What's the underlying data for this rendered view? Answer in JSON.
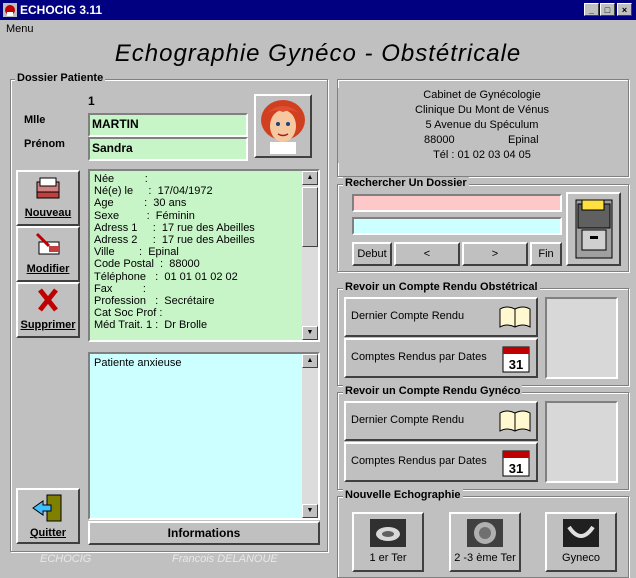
{
  "window": {
    "title": "ECHOCIG 3.11",
    "minimize": "_",
    "maximize": "□",
    "close": "×"
  },
  "menu": {
    "item": "Menu"
  },
  "banner": {
    "title": "Echographie Gynéco - Obstétricale"
  },
  "patient": {
    "group_label": "Dossier Patiente",
    "number": "1",
    "civility_label": "Mlle",
    "name": "MARTIN",
    "firstname_label": "Prénom",
    "firstname": "Sandra",
    "details": [
      "Née          :",
      "Né(e) le     :  17/04/1972",
      "Age          :  30 ans",
      "Sexe         :  Féminin",
      "Adress 1     :  17 rue des Abeilles",
      "Adress 2     :  17 rue des Abeilles",
      "Ville        :  Epinal",
      "Code Postal  :  88000",
      "Téléphone   :  01 01 01 02 02",
      "Fax          :",
      "Profession   :  Secrétaire",
      "Cat Soc Prof :",
      "Méd Trait. 1 :  Dr Brolle"
    ],
    "notes": "Patiente anxieuse",
    "informations_label": "Informations"
  },
  "side_buttons": {
    "nouveau": "Nouveau",
    "modifier": "Modifier",
    "supprimer": "Supprimer",
    "quitter": "Quitter"
  },
  "cabinet": {
    "lines": [
      "Cabinet de Gynécologie",
      "Clinique Du Mont de Vénus",
      "5 Avenue du Spéculum"
    ],
    "postal": "88000",
    "city": "Epinal",
    "phone": "Tél :  01 02 03 04 05"
  },
  "search": {
    "group_label": "Rechercher  Un Dossier",
    "field1": "",
    "field2": "",
    "debut": "Debut",
    "prev": "<",
    "next": ">",
    "fin": "Fin"
  },
  "obst": {
    "group_label": "Revoir un Compte Rendu Obstétrical",
    "last": "Dernier Compte Rendu",
    "by_dates": "Comptes Rendus par Dates",
    "cal_day": "31"
  },
  "gyn": {
    "group_label": "Revoir un Compte Rendu Gynéco",
    "last": "Dernier Compte Rendu",
    "by_dates": "Comptes Rendus par Dates",
    "cal_day": "31"
  },
  "echo": {
    "group_label": "Nouvelle Echographie",
    "t1": "1 er Ter",
    "t23": "2 -3 ème Ter",
    "gyneco": "Gyneco"
  },
  "footer": {
    "left": "ECHOCIG",
    "right": "Francois DELANOUE"
  },
  "colors": {
    "title_bar": "#000080",
    "green_field": "#c8f5c8",
    "notes_bg": "#ccffff",
    "search_pink": "#ffc8c8",
    "search_cyan": "#ccffff"
  }
}
